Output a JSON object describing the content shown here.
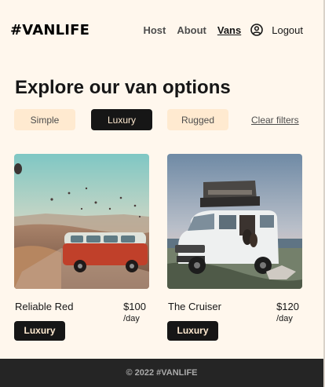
{
  "brand": {
    "logo": "#VANLIFE"
  },
  "nav": {
    "items": [
      {
        "label": "Host"
      },
      {
        "label": "About"
      },
      {
        "label": "Vans"
      }
    ],
    "user_icon": "user-circle-icon",
    "logout_label": "Logout"
  },
  "page": {
    "title": "Explore our van options"
  },
  "filters": {
    "options": [
      {
        "label": "Simple",
        "selected": false
      },
      {
        "label": "Luxury",
        "selected": true
      },
      {
        "label": "Rugged",
        "selected": false
      }
    ],
    "clear_label": "Clear filters"
  },
  "vans": [
    {
      "name": "Reliable Red",
      "price": "$100",
      "per": "/day",
      "type": "Luxury"
    },
    {
      "name": "The Cruiser",
      "price": "$120",
      "per": "/day",
      "type": "Luxury"
    }
  ],
  "footer": {
    "text": "© 2022 #VANLIFE"
  },
  "colors": {
    "background": "#fff7ed",
    "chip": "#ffead0",
    "dark": "#161616",
    "footer": "#252525"
  }
}
